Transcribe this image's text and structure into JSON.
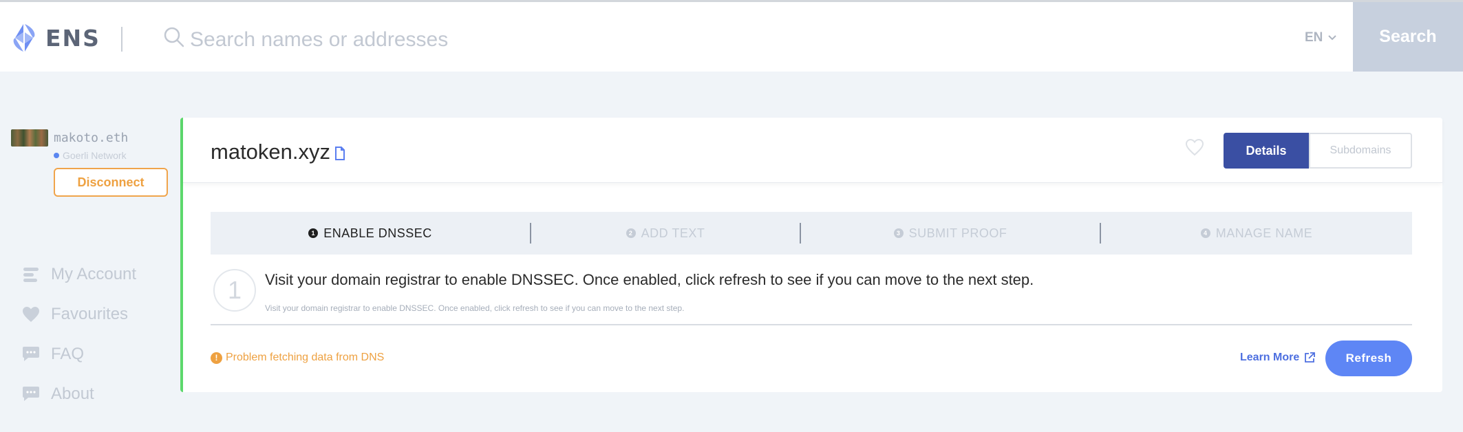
{
  "header": {
    "logo_text": "ENS",
    "search_placeholder": "Search names or addresses",
    "language": "EN",
    "search_button": "Search"
  },
  "sidebar": {
    "user_name": "makoto.eth",
    "network": "Goerli Network",
    "disconnect_label": "Disconnect",
    "nav": [
      {
        "label": "My Account",
        "icon": "account-icon"
      },
      {
        "label": "Favourites",
        "icon": "heart-icon"
      },
      {
        "label": "FAQ",
        "icon": "chat-icon"
      },
      {
        "label": "About",
        "icon": "chat-icon"
      }
    ]
  },
  "main": {
    "domain": "matoken.xyz",
    "tabs": {
      "details": "Details",
      "subdomains": "Subdomains"
    },
    "steps": [
      {
        "num": "1",
        "label": "ENABLE DNSSEC",
        "active": true
      },
      {
        "num": "2",
        "label": "ADD TEXT",
        "active": false
      },
      {
        "num": "3",
        "label": "SUBMIT PROOF",
        "active": false
      },
      {
        "num": "4",
        "label": "MANAGE NAME",
        "active": false
      }
    ],
    "current_step_number": "1",
    "step_title": "Visit your domain registrar to enable DNSSEC. Once enabled, click refresh to see if you can move to the next step.",
    "step_description": "Visit your domain registrar to enable DNSSEC. Once enabled, click refresh to see if you can move to the next step.",
    "warning": "Problem fetching data from DNS",
    "learn_more": "Learn More",
    "refresh_label": "Refresh"
  },
  "colors": {
    "brand_blue": "#3a4fa3",
    "refresh_blue": "#5e86f5",
    "warning_orange": "#eea141",
    "success_green": "#5cd86c"
  }
}
